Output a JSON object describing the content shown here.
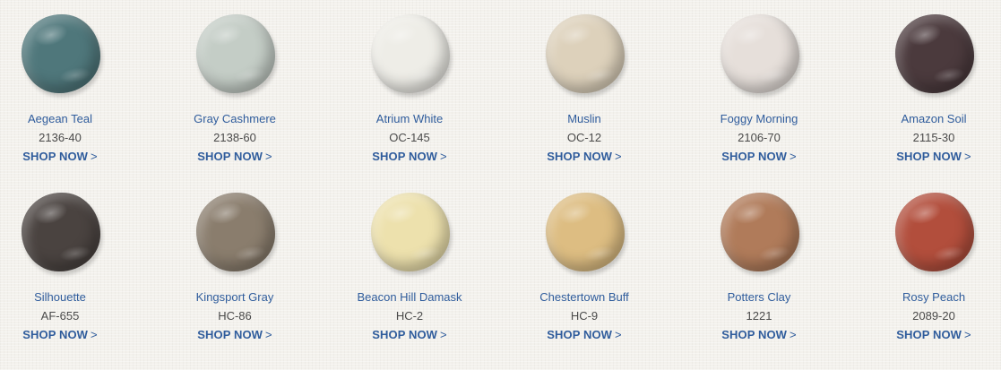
{
  "swatches": [
    {
      "name": "Aegean Teal",
      "code": "2136-40",
      "color": "#4f777b",
      "cta": "SHOP NOW",
      "chevron": ">"
    },
    {
      "name": "Gray Cashmere",
      "code": "2138-60",
      "color": "#c4cdc6",
      "cta": "SHOP NOW",
      "chevron": ">"
    },
    {
      "name": "Atrium White",
      "code": "OC-145",
      "color": "#eeede7",
      "cta": "SHOP NOW",
      "chevron": ">"
    },
    {
      "name": "Muslin",
      "code": "OC-12",
      "color": "#ddd1bb",
      "cta": "SHOP NOW",
      "chevron": ">"
    },
    {
      "name": "Foggy Morning",
      "code": "2106-70",
      "color": "#e6dfda",
      "cta": "SHOP NOW",
      "chevron": ">"
    },
    {
      "name": "Amazon Soil",
      "code": "2115-30",
      "color": "#4b3a3d",
      "cta": "SHOP NOW",
      "chevron": ">"
    },
    {
      "name": "Silhouette",
      "code": "AF-655",
      "color": "#4a4340",
      "cta": "SHOP NOW",
      "chevron": ">"
    },
    {
      "name": "Kingsport Gray",
      "code": "HC-86",
      "color": "#8a7d6d",
      "cta": "SHOP NOW",
      "chevron": ">"
    },
    {
      "name": "Beacon Hill Damask",
      "code": "HC-2",
      "color": "#ede1ad",
      "cta": "SHOP NOW",
      "chevron": ">"
    },
    {
      "name": "Chestertown Buff",
      "code": "HC-9",
      "color": "#ddbd82",
      "cta": "SHOP NOW",
      "chevron": ">"
    },
    {
      "name": "Potters Clay",
      "code": "1221",
      "color": "#b07b5a",
      "cta": "SHOP NOW",
      "chevron": ">"
    },
    {
      "name": "Rosy Peach",
      "code": "2089-20",
      "color": "#b24e3c",
      "cta": "SHOP NOW",
      "chevron": ">"
    }
  ]
}
